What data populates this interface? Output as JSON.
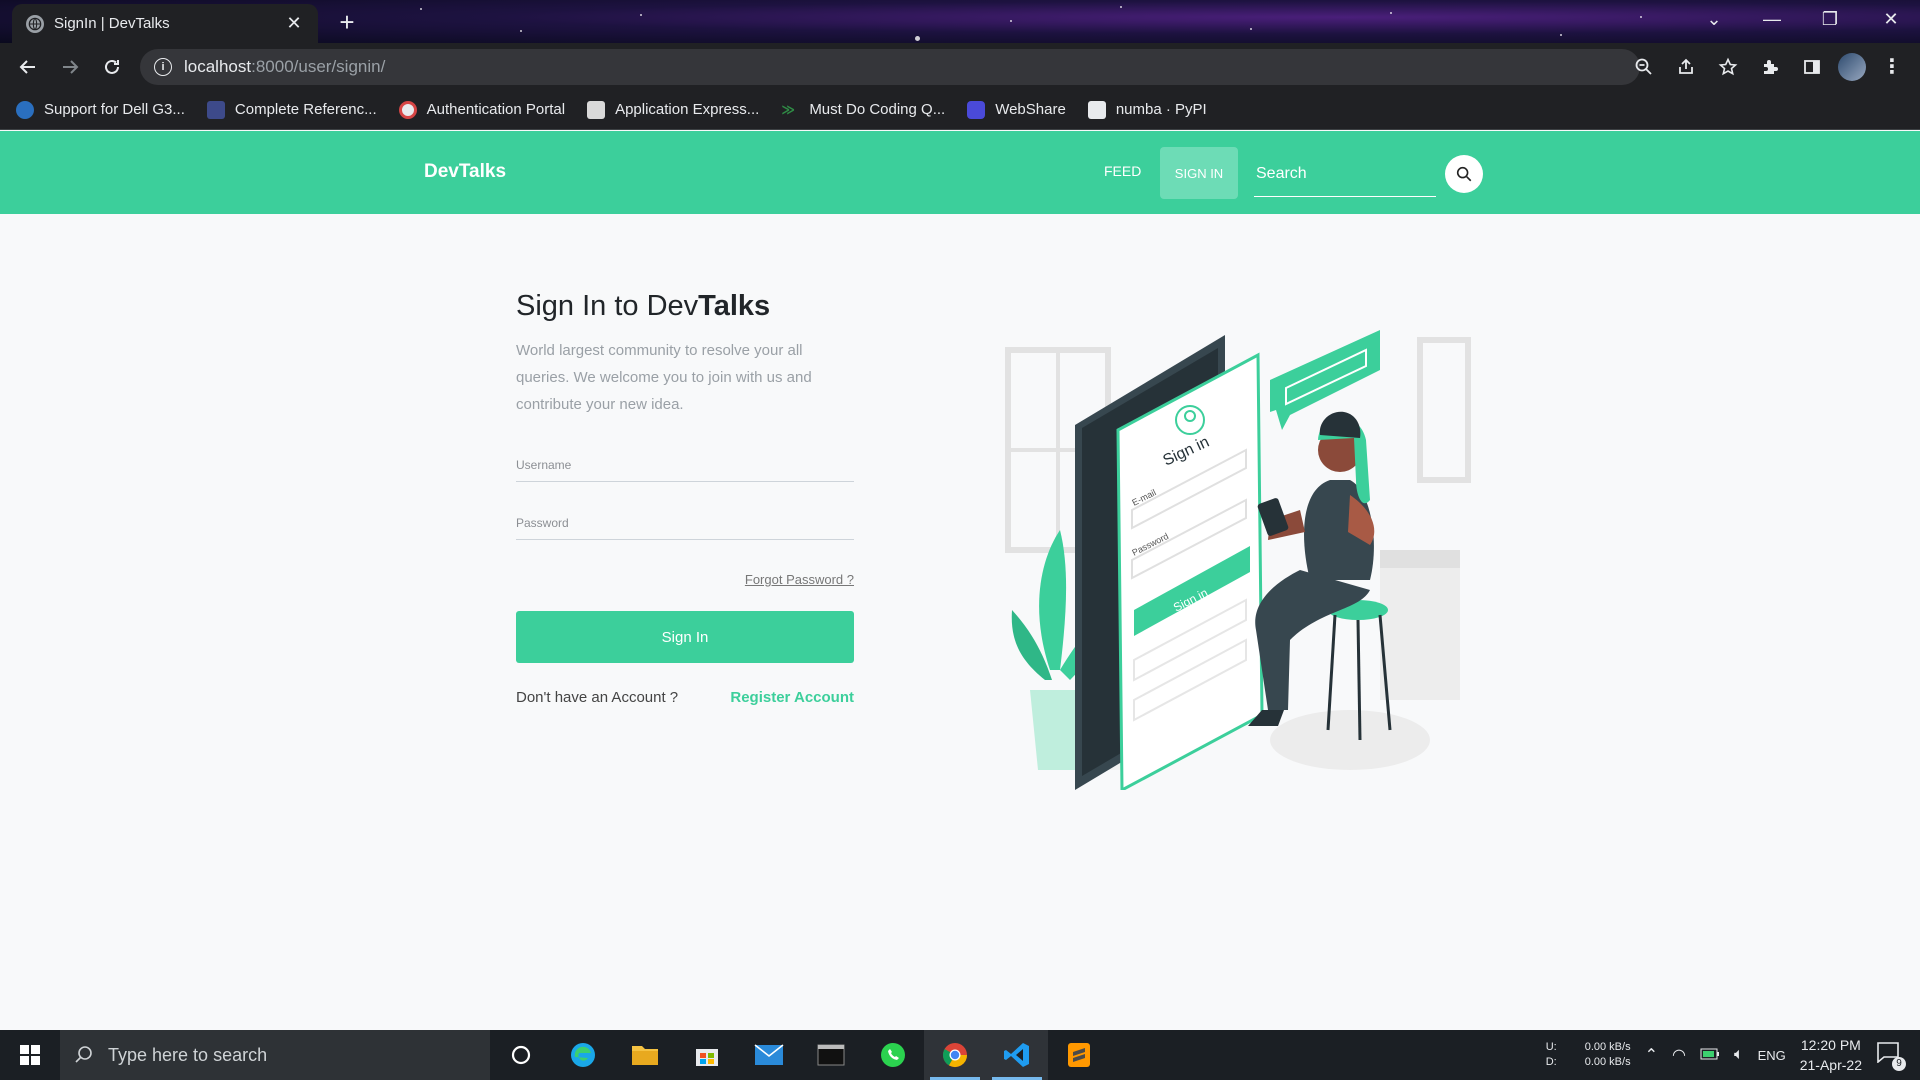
{
  "browser": {
    "tab_title": "SignIn | DevTalks",
    "url_host": "localhost",
    "url_path": ":8000/user/signin/",
    "bookmarks": [
      {
        "label": "Support for Dell G3...",
        "icon": "dell-icon",
        "color": "#2a6fbf"
      },
      {
        "label": "Complete Referenc...",
        "icon": "hackerrank-icon",
        "color": "#3d4a8a"
      },
      {
        "label": "Authentication Portal",
        "icon": "portal-icon",
        "color": "#d64545"
      },
      {
        "label": "Application Express...",
        "icon": "page-icon",
        "color": "#d9d9d9"
      },
      {
        "label": "Must Do Coding Q...",
        "icon": "gfg-icon",
        "color": "#2f8d46"
      },
      {
        "label": "WebShare",
        "icon": "webshare-icon",
        "color": "#4a4ad9"
      },
      {
        "label": "numba · PyPI",
        "icon": "pypi-icon",
        "color": "#e8eaed"
      }
    ]
  },
  "navbar": {
    "brand": "DevTalks",
    "feed": "FEED",
    "signin": "SIGN IN",
    "search_placeholder": "Search"
  },
  "signin": {
    "heading_prefix": "Sign In to Dev",
    "heading_bold": "Talks",
    "subtitle": "World largest community to resolve your all queries. We welcome you to join with us and contribute your new idea.",
    "username_placeholder": "Username",
    "password_placeholder": "Password",
    "forgot": "Forgot Password ?",
    "button": "Sign In",
    "no_account": "Don't have an Account ?",
    "register": "Register Account"
  },
  "illustration": {
    "phone_label": "Sign in",
    "email_label": "E-mail",
    "password_label": "Password",
    "button_label": "Sign in"
  },
  "taskbar": {
    "search_placeholder": "Type here to search",
    "upload_label": "U:",
    "download_label": "D:",
    "upload_speed": "0.00 kB/s",
    "download_speed": "0.00 kB/s",
    "language": "ENG",
    "time": "12:20 PM",
    "date": "21-Apr-22",
    "notifications": "9"
  },
  "colors": {
    "accent": "#3ccf9b",
    "accent_light": "#6ddcb6"
  }
}
